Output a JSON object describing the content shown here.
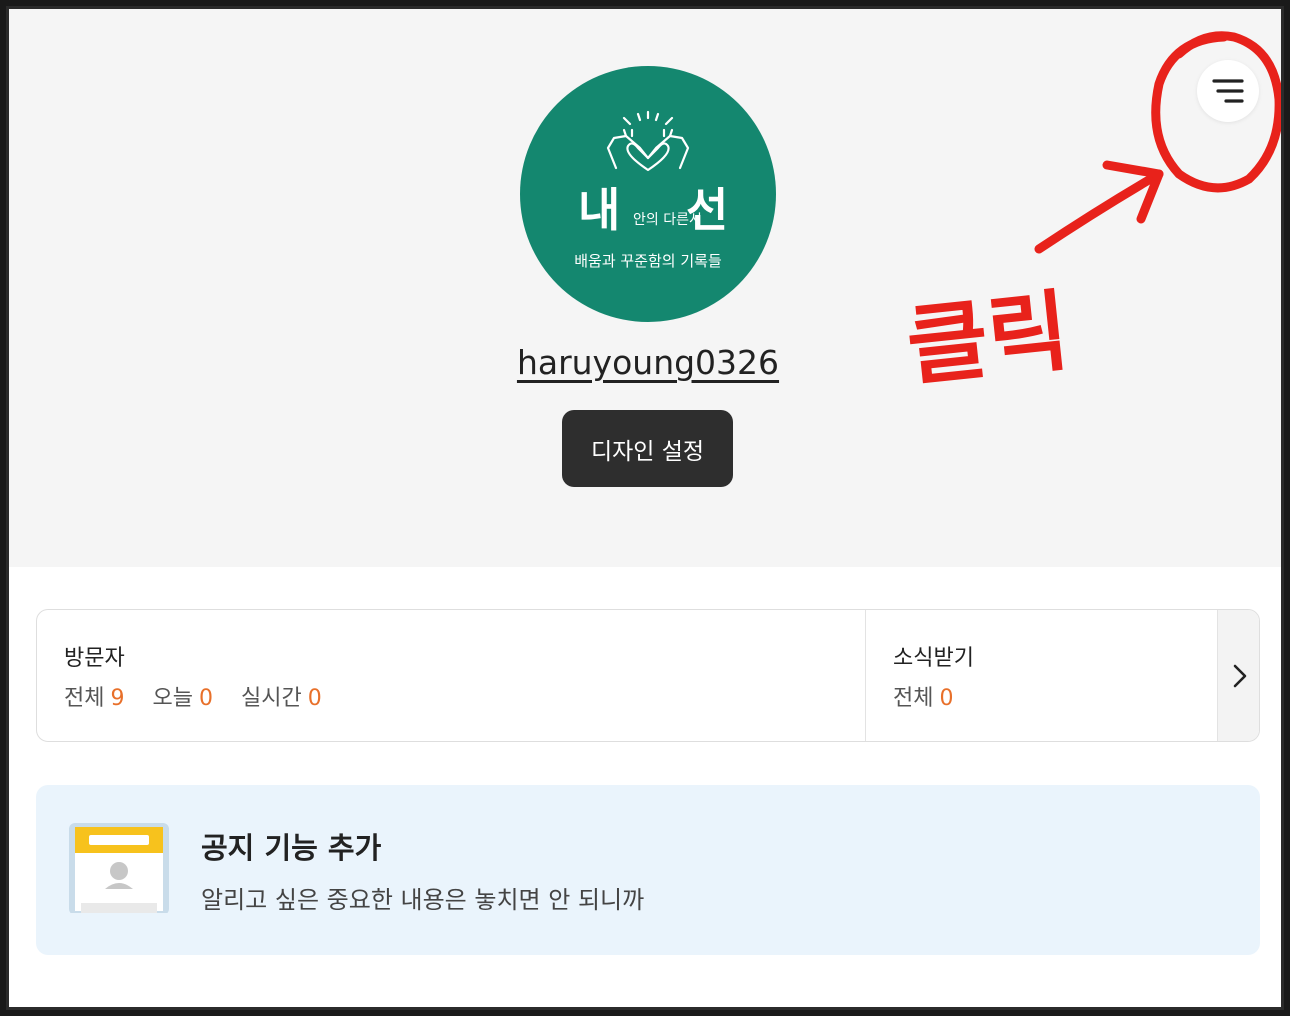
{
  "profile": {
    "logo": {
      "big_left": "내",
      "big_right": "선",
      "small_middle": "안의 다른시",
      "bottom_line": "배움과 꾸준함의 기록들"
    },
    "username": "haruyoung0326",
    "design_button": "디자인 설정"
  },
  "annotation": {
    "text": "클릭",
    "color": "#e8221b"
  },
  "stats": {
    "visitors": {
      "title": "방문자",
      "items": [
        {
          "label": "전체",
          "value": "9"
        },
        {
          "label": "오늘",
          "value": "0"
        },
        {
          "label": "실시간",
          "value": "0"
        }
      ]
    },
    "subscribe": {
      "title": "소식받기",
      "items": [
        {
          "label": "전체",
          "value": "0"
        }
      ]
    }
  },
  "notice": {
    "title": "공지 기능 추가",
    "description": "알리고 싶은 중요한 내용은 놓치면 안 되니까"
  },
  "colors": {
    "logo_green": "#14876f",
    "accent_orange": "#e8702a",
    "notice_bg": "#eaf4fc",
    "button_dark": "#2e2e2e"
  },
  "icons": [
    "menu-icon",
    "chevron-right-icon",
    "heart-hands-icon",
    "notice-illustration-icon"
  ]
}
